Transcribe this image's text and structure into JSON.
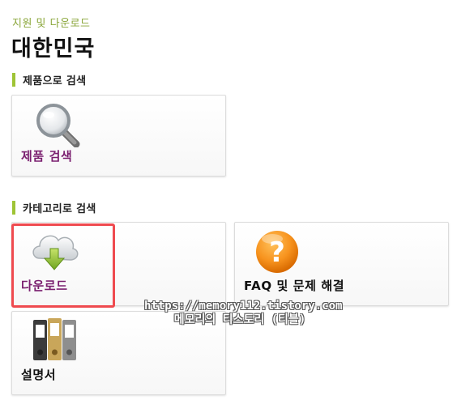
{
  "header": {
    "breadcrumb": "지원 및 다운로드",
    "title": "대한민국"
  },
  "sections": {
    "product_search": {
      "label": "제품으로 검색"
    },
    "category_search": {
      "label": "카테고리로 검색"
    }
  },
  "cards": {
    "product_search": {
      "label": "제품 검색",
      "icon": "magnifier-icon"
    },
    "download": {
      "label": "다운로드",
      "icon": "cloud-download-icon"
    },
    "faq": {
      "label": "FAQ 및 문제 해결",
      "icon": "question-icon"
    },
    "manual": {
      "label": "설명서",
      "icon": "binders-icon"
    }
  },
  "watermark": {
    "url": "https://memory112.tistory.com",
    "caption": "메모리의 티스토리 (티블)"
  },
  "colors": {
    "accent_green": "#9fc436",
    "label_purple": "#7a1f6f",
    "highlight_red": "#ef4a4f",
    "breadcrumb_green": "#8aa63a"
  }
}
